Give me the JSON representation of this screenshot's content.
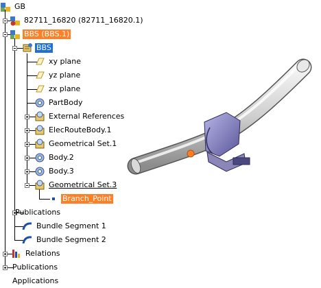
{
  "tree": {
    "root": "GB",
    "product_1": "82711_16820 (82711_16820.1)",
    "product_2": "BBS (BBS.1)",
    "part": "BBS",
    "xy_plane": "xy plane",
    "yz_plane": "yz plane",
    "zx_plane": "zx plane",
    "partbody": "PartBody",
    "external_refs": "External References",
    "elecroute": "ElecRouteBody.1",
    "geoset1": "Geometrical Set.1",
    "body2": "Body.2",
    "body3": "Body.3",
    "geoset3": "Geometrical Set.3",
    "branch_point": "Branch_Point",
    "publications_inner": "Publications",
    "bundle1": "Bundle Segment 1",
    "bundle2": "Bundle Segment 2",
    "relations": "Relations",
    "publications_outer": "Publications",
    "applications": "Applications"
  },
  "colors": {
    "selection_orange": "#ff7f27",
    "selection_blue": "#1e6fd9",
    "bundle_gray": "#d9d9d9",
    "clip_purple": "#8b87c9",
    "branch_point": "#ff7f27"
  },
  "viewport": {
    "model": "harness-bundle-with-clip"
  }
}
